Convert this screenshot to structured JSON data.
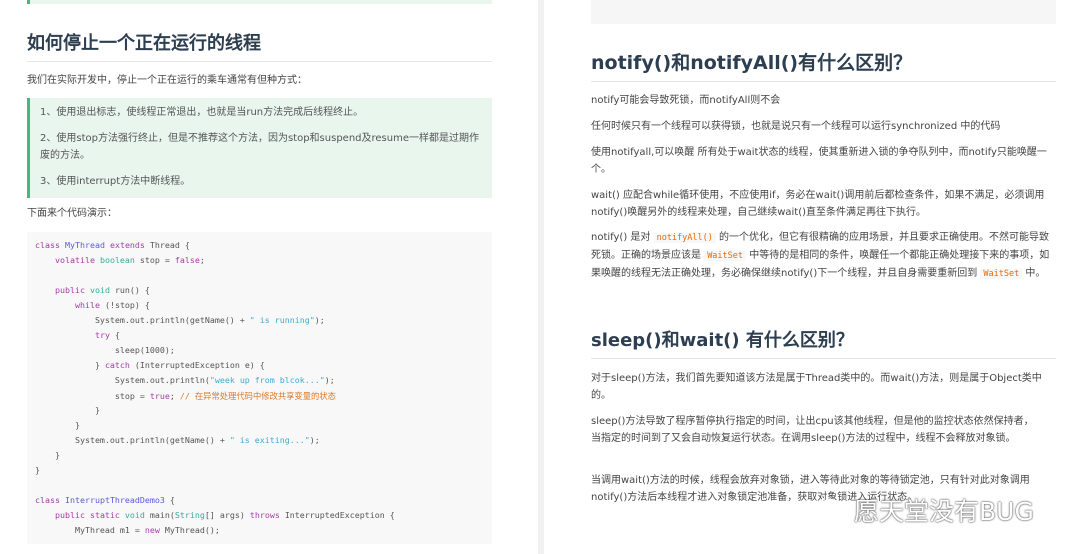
{
  "left": {
    "heading": "如何停止一个正在运行的线程",
    "intro": "我们在实际开发中，停止一个正在运行的乘车通常有但种方式：",
    "quote": [
      "1、使用退出标志，使线程正常退出，也就是当run方法完成后线程终止。",
      "2、使用stop方法强行终止，但是不推荐这个方法，因为stop和suspend及resume一样都是过期作废的方法。",
      "3、使用interrupt方法中断线程。"
    ],
    "code_intro": "下面来个代码演示：",
    "code": [
      [
        [
          "kw",
          "class "
        ],
        [
          "cn",
          "MyThread "
        ],
        [
          "kw",
          "extends "
        ],
        [
          "pl",
          "Thread {"
        ]
      ],
      [
        [
          "pl",
          "    "
        ],
        [
          "kw",
          "volatile "
        ],
        [
          "ty",
          "boolean "
        ],
        [
          "pl",
          "stop = "
        ],
        [
          "kw",
          "false"
        ],
        [
          "pl",
          ";"
        ]
      ],
      [],
      [
        [
          "pl",
          "    "
        ],
        [
          "kw",
          "public "
        ],
        [
          "ty",
          "void "
        ],
        [
          "pl",
          "run() {"
        ]
      ],
      [
        [
          "pl",
          "        "
        ],
        [
          "kw",
          "while "
        ],
        [
          "pl",
          "(!stop) {"
        ]
      ],
      [
        [
          "pl",
          "            System.out.println(getName() + "
        ],
        [
          "st",
          "\" is running\""
        ],
        [
          "pl",
          ");"
        ]
      ],
      [
        [
          "pl",
          "            "
        ],
        [
          "kw",
          "try "
        ],
        [
          "pl",
          "{"
        ]
      ],
      [
        [
          "pl",
          "                sleep(1000);"
        ]
      ],
      [
        [
          "pl",
          "            } "
        ],
        [
          "kw",
          "catch "
        ],
        [
          "pl",
          "(InterruptedException e) {"
        ]
      ],
      [
        [
          "pl",
          "                System.out.println("
        ],
        [
          "st",
          "\"week up from blcok...\""
        ],
        [
          "pl",
          ");"
        ]
      ],
      [
        [
          "pl",
          "                stop = "
        ],
        [
          "kw",
          "true"
        ],
        [
          "pl",
          "; "
        ],
        [
          "cm",
          "// 在异常处理代码中修改共享变量的状态"
        ]
      ],
      [
        [
          "pl",
          "            }"
        ]
      ],
      [
        [
          "pl",
          "        }"
        ]
      ],
      [
        [
          "pl",
          "        System.out.println(getName() + "
        ],
        [
          "st",
          "\" is exiting...\""
        ],
        [
          "pl",
          ");"
        ]
      ],
      [
        [
          "pl",
          "    }"
        ]
      ],
      [
        [
          "pl",
          "}"
        ]
      ],
      [],
      [
        [
          "kw",
          "class "
        ],
        [
          "cn",
          "InterruptThreadDemo3 "
        ],
        [
          "pl",
          "{"
        ]
      ],
      [
        [
          "pl",
          "    "
        ],
        [
          "kw",
          "public static "
        ],
        [
          "ty",
          "void "
        ],
        [
          "pl",
          "main("
        ],
        [
          "ty",
          "String"
        ],
        [
          "pl",
          "[] args) "
        ],
        [
          "kw",
          "throws "
        ],
        [
          "pl",
          "InterruptedException {"
        ]
      ],
      [
        [
          "pl",
          "        MyThread m1 = "
        ],
        [
          "kw",
          "new "
        ],
        [
          "pl",
          "MyThread();"
        ]
      ]
    ]
  },
  "right": {
    "heading1": "notify()和notifyAll()有什么区别？",
    "p1": "notify可能会导致死锁，而notifyAll则不会",
    "p2": "任何时候只有一个线程可以获得锁，也就是说只有一个线程可以运行synchronized 中的代码",
    "p3": "使用notifyall,可以唤醒 所有处于wait状态的线程，使其重新进入锁的争夺队列中，而notify只能唤醒一个。",
    "p4": "wait() 应配合while循环使用，不应使用if，务必在wait()调用前后都检查条件，如果不满足，必须调用notify()唤醒另外的线程来处理，自己继续wait()直至条件满足再往下执行。",
    "p5a": "notify() 是对 ",
    "p5code1": "notifyAll()",
    "p5b": " 的一个优化，但它有很精确的应用场景，并且要求正确使用。不然可能导致死锁。正确的场景应该是 ",
    "p5code2": "WaitSet",
    "p5c": " 中等待的是相同的条件，唤醒任一个都能正确处理接下来的事项，如果唤醒的线程无法正确处理，务必确保继续notify()下一个线程，并且自身需要重新回到 ",
    "p5code3": "WaitSet",
    "p5d": " 中。",
    "heading2": "sleep()和wait() 有什么区别？",
    "q1": "对于sleep()方法，我们首先要知道该方法是属于Thread类中的。而wait()方法，则是属于Object类中的。",
    "q2": "sleep()方法导致了程序暂停执行指定的时间，让出cpu该其他线程，但是他的监控状态依然保持者，当指定的时间到了又会自动恢复运行状态。在调用sleep()方法的过程中，线程不会释放对象锁。",
    "q3": "当调用wait()方法的时候，线程会放弃对象锁，进入等待此对象的等待锁定池，只有针对此对象调用notify()方法后本线程才进入对象锁定池准备，获取对象锁进入运行状态。"
  },
  "watermark": "愿天堂没有BUG"
}
